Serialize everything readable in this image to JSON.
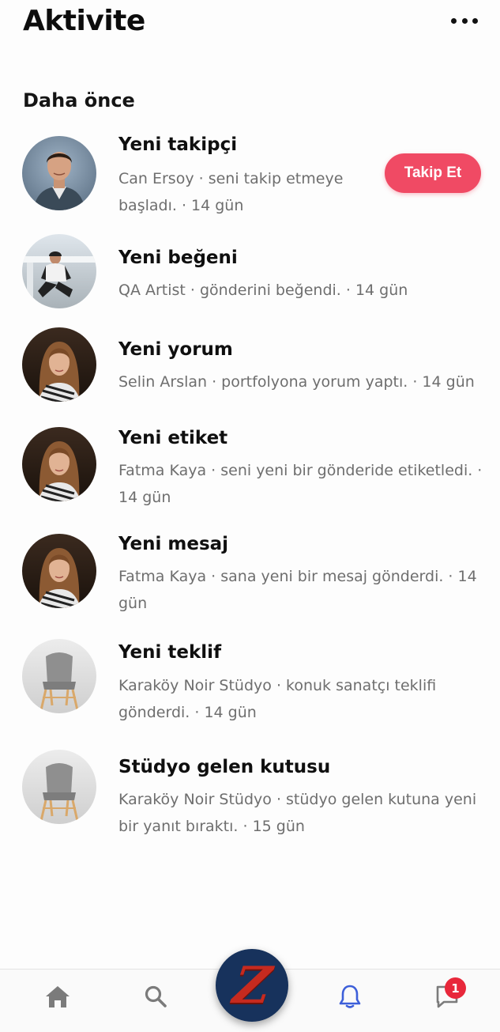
{
  "header": {
    "title": "Aktivite",
    "more_icon": "more-dots-icon"
  },
  "section": {
    "title": "Daha önce"
  },
  "items": [
    {
      "title": "Yeni takipçi",
      "description": "Can Ersoy · seni takip etmeye başladı. · 14 gün",
      "avatar": "man-portrait",
      "action_label": "Takip Et"
    },
    {
      "title": "Yeni beğeni",
      "description": "QA Artist · gönderini beğendi. · 14 gün",
      "avatar": "man-sitting-photo"
    },
    {
      "title": "Yeni yorum",
      "description": "Selin Arslan · portfolyona yorum yaptı. · 14 gün",
      "avatar": "woman-portrait"
    },
    {
      "title": "Yeni etiket",
      "description": "Fatma Kaya · seni yeni bir gönderide etiketledi. · 14 gün",
      "avatar": "woman-portrait"
    },
    {
      "title": "Yeni mesaj",
      "description": "Fatma Kaya · sana yeni bir mesaj gönderdi. · 14 gün",
      "avatar": "woman-portrait"
    },
    {
      "title": "Yeni teklif",
      "description": "Karaköy Noir Stüdyo · konuk sanatçı teklifi gönderdi. · 14 gün",
      "avatar": "chair-photo"
    },
    {
      "title": "Stüdyo gelen kutusu",
      "description": "Karaköy Noir Stüdyo · stüdyo gelen kutuna yeni bir yanıt bıraktı. · 15 gün",
      "avatar": "chair-photo"
    }
  ],
  "tabbar": {
    "tabs": [
      "home-icon",
      "search-icon",
      "app-logo",
      "bell-icon",
      "chat-icon"
    ],
    "center_logo": "Z",
    "messages_badge": "1",
    "active_tab": "bell-icon",
    "active_color": "#3d5fd9"
  },
  "colors": {
    "accent": "#f04a64",
    "badge": "#e8283b"
  }
}
